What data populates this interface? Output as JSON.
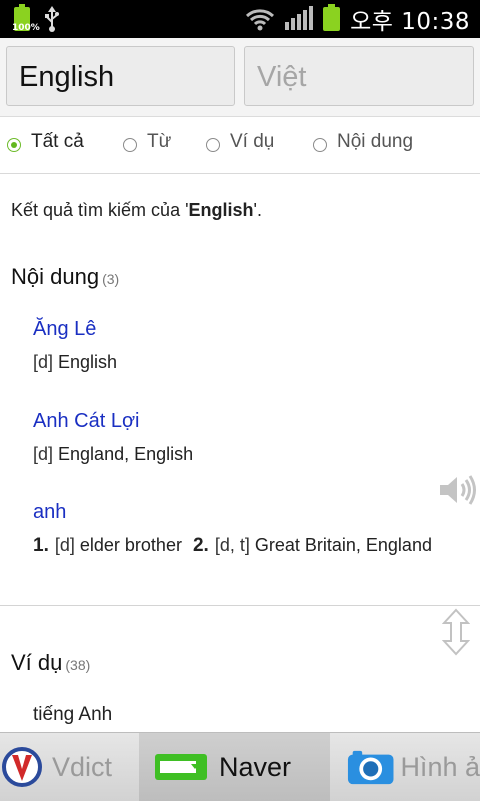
{
  "status_bar": {
    "battery_percent": "100%",
    "time": "오후 10:38"
  },
  "languages": {
    "source": "English",
    "target": "Việt"
  },
  "filters": [
    {
      "label": "Tất cả",
      "selected": true
    },
    {
      "label": "Từ",
      "selected": false
    },
    {
      "label": "Ví dụ",
      "selected": false
    },
    {
      "label": "Nội dung",
      "selected": false
    }
  ],
  "summary": {
    "prefix": "Kết quả tìm kiếm của '",
    "query": "English",
    "suffix": "'."
  },
  "content_section": {
    "title": "Nội dung",
    "count": "(3)",
    "entries": [
      {
        "word": "Ăng Lê",
        "pos": "[d]",
        "definition": "English"
      },
      {
        "word": "Anh Cát Lợi",
        "pos": "[d]",
        "definition": "England, English"
      },
      {
        "word": "anh",
        "sense1_num": "1.",
        "sense1_pos": "[d]",
        "sense1_text": "elder brother",
        "sense2_num": "2.",
        "sense2_pos": "[d, t]",
        "sense2_text": "Great Britain, England"
      }
    ]
  },
  "examples_section": {
    "title": "Ví dụ",
    "count": "(38)",
    "first_item": "tiếng Anh"
  },
  "bottom_tabs": {
    "vdict": "Vdict",
    "naver": "Naver",
    "image": "Hình ả"
  },
  "icons": {
    "usb": "usb-icon",
    "wifi": "wifi-icon",
    "signal": "signal-icon",
    "speaker": "speaker-icon",
    "camera": "camera-icon"
  },
  "colors": {
    "link_blue": "#1a2fc2",
    "accent_green": "#63b81f"
  }
}
